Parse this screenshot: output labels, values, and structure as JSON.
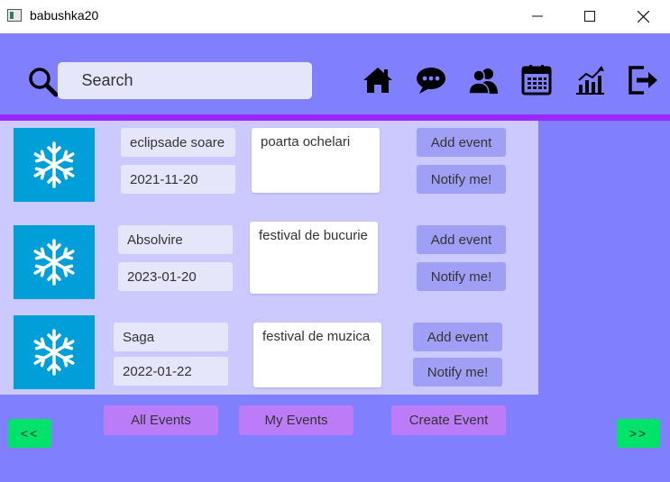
{
  "window": {
    "title": "babushka20",
    "minimize_icon": "minimize-icon",
    "maximize_icon": "maximize-icon",
    "close_icon": "close-icon"
  },
  "header": {
    "search_label": "Search",
    "search_value": "",
    "nav_icons": [
      "home-icon",
      "chat-icon",
      "users-icon",
      "calendar-icon",
      "stats-icon",
      "logout-icon"
    ]
  },
  "events": [
    {
      "name": "eclipsade soare",
      "date": "2021-11-20",
      "description": "poarta ochelari",
      "add_label": "Add event",
      "notify_label": "Notify me!",
      "image": "snowflake-icon"
    },
    {
      "name": "Absolvire",
      "date": "2023-01-20",
      "description": "festival de bucurie",
      "add_label": "Add event",
      "notify_label": "Notify me!",
      "image": "snowflake-icon"
    },
    {
      "name": "Saga",
      "date": "2022-01-22",
      "description": "festival de muzica",
      "add_label": "Add event",
      "notify_label": "Notify me!",
      "image": "snowflake-icon"
    }
  ],
  "bottom_nav": {
    "all_events": "All Events",
    "my_events": "My Events",
    "create_event": "Create Event",
    "prev": "<<",
    "next": ">>"
  },
  "colors": {
    "background": "#8080ff",
    "panel": "#cbc9ff",
    "divider": "#9b29ff",
    "thumb": "#009fd9",
    "action_button": "#9f9ff5",
    "nav_button": "#bc7cf8",
    "pager_button": "#00e36a"
  }
}
